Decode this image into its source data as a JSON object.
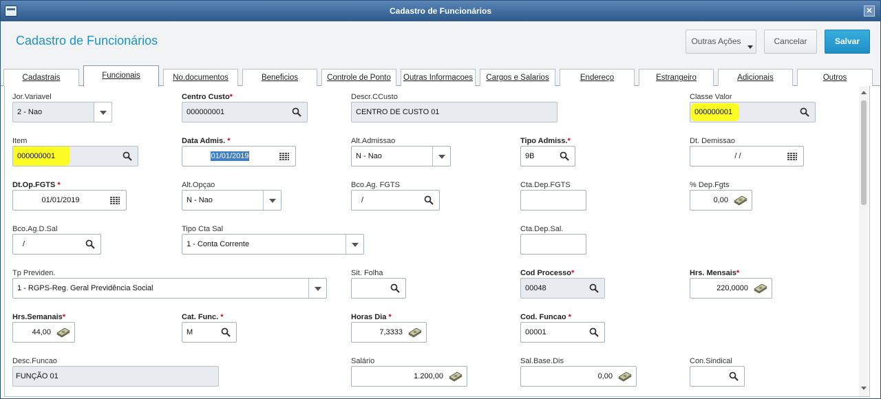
{
  "window": {
    "title": "Cadastro de Funcionários",
    "close_glyph": "✕"
  },
  "header": {
    "title": "Cadastro de Funcionários",
    "buttons": {
      "outras_acoes": "Outras Ações",
      "cancelar": "Cancelar",
      "salvar": "Salvar"
    }
  },
  "tabs": [
    {
      "label": "Cadastrais",
      "active": false
    },
    {
      "label": "Funcionais",
      "active": true
    },
    {
      "label": "No.documentos",
      "active": false
    },
    {
      "label": "Beneficios",
      "active": false
    },
    {
      "label": "Controle de Ponto",
      "active": false
    },
    {
      "label": "Outras Informacoes",
      "active": false
    },
    {
      "label": "Cargos e Salarios",
      "active": false
    },
    {
      "label": "Endereço",
      "active": false
    },
    {
      "label": "Estrangeiro",
      "active": false
    },
    {
      "label": "Adicionais",
      "active": false
    },
    {
      "label": "Outros",
      "active": false
    }
  ],
  "fields": {
    "jor_variavel": {
      "label": "Jor.Variavel",
      "value": "2 - Nao"
    },
    "centro_custo": {
      "label": "Centro Custo",
      "value": "000000001"
    },
    "descr_ccusto": {
      "label": "Descr.CCusto",
      "value": "CENTRO DE CUSTO 01"
    },
    "classe_valor": {
      "label": "Classe Valor",
      "value": "000000001"
    },
    "item": {
      "label": "Item",
      "value": "000000001"
    },
    "data_admis": {
      "label": "Data Admis.",
      "value": "01/01/2019"
    },
    "alt_admissao": {
      "label": "Alt.Admissao",
      "value": "N - Nao"
    },
    "tipo_admiss": {
      "label": "Tipo Admiss.",
      "value": "9B"
    },
    "dt_demissao": {
      "label": "Dt. Demissao",
      "value": "/ /"
    },
    "dt_op_fgts": {
      "label": "Dt.Op.FGTS",
      "value": "01/01/2019"
    },
    "alt_opcao": {
      "label": "Alt.Opçao",
      "value": "N - Nao"
    },
    "bco_ag_fgts": {
      "label": "Bco.Ag. FGTS",
      "value": "/"
    },
    "cta_dep_fgts": {
      "label": "Cta.Dep.FGTS",
      "value": ""
    },
    "pct_dep_fgts": {
      "label": "% Dep.Fgts",
      "value": "0,00"
    },
    "bco_ag_d_sal": {
      "label": "Bco.Ag.D.Sal",
      "value": "/"
    },
    "tipo_cta_sal": {
      "label": "Tipo Cta Sal",
      "value": "1 - Conta Corrente"
    },
    "cta_dep_sal": {
      "label": "Cta.Dep.Sal.",
      "value": ""
    },
    "tp_previden": {
      "label": "Tp Previden.",
      "value": "1 - RGPS-Reg. Geral Previdência Social"
    },
    "sit_folha": {
      "label": "Sit. Folha",
      "value": ""
    },
    "cod_processo": {
      "label": "Cod Processo",
      "value": "00048"
    },
    "hrs_mensais": {
      "label": "Hrs. Mensais",
      "value": "220,0000"
    },
    "hrs_semanais": {
      "label": "Hrs.Semanais",
      "value": "44,00"
    },
    "cat_func": {
      "label": "Cat. Func.",
      "value": "M"
    },
    "horas_dia": {
      "label": "Horas Dia",
      "value": "7,3333"
    },
    "cod_funcao": {
      "label": "Cod. Funcao",
      "value": "00001"
    },
    "desc_funcao": {
      "label": "Desc.Funcao",
      "value": "FUNÇÃO 01"
    },
    "salario": {
      "label": "Salário",
      "value": "1.200,00"
    },
    "sal_base_dis": {
      "label": "Sal.Base.Dis",
      "value": "0,00"
    },
    "con_sindical": {
      "label": "Con.Sindical",
      "value": ""
    }
  },
  "required_marker": "*",
  "colors": {
    "title_blue": "#1c93c8",
    "save_button": "#2a9fd6",
    "highlight": "#ffff00",
    "required_star": "#d0021b"
  }
}
